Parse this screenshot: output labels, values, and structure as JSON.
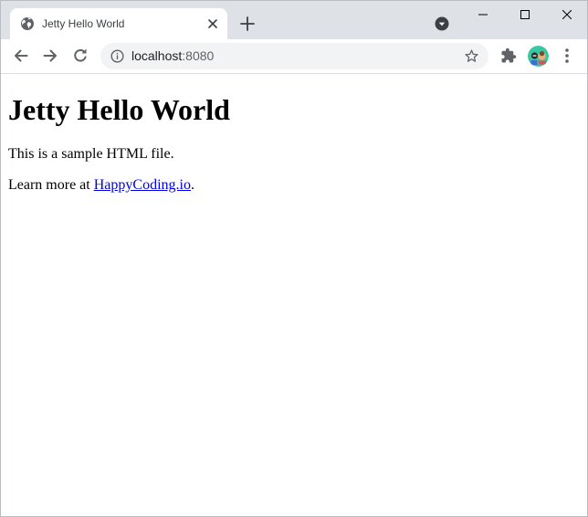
{
  "tab": {
    "title": "Jetty Hello World",
    "favicon": "globe-icon"
  },
  "address_bar": {
    "host": "localhost",
    "port": ":8080"
  },
  "page": {
    "heading": "Jetty Hello World",
    "paragraph1": "This is a sample HTML file.",
    "paragraph2_prefix": "Learn more at ",
    "link_text": "HappyCoding.io",
    "paragraph2_suffix": "."
  },
  "colors": {
    "tabstrip_bg": "#dee1e6",
    "omnibox_bg": "#f1f3f4",
    "link": "#0000ee",
    "icon": "#5f6368"
  }
}
